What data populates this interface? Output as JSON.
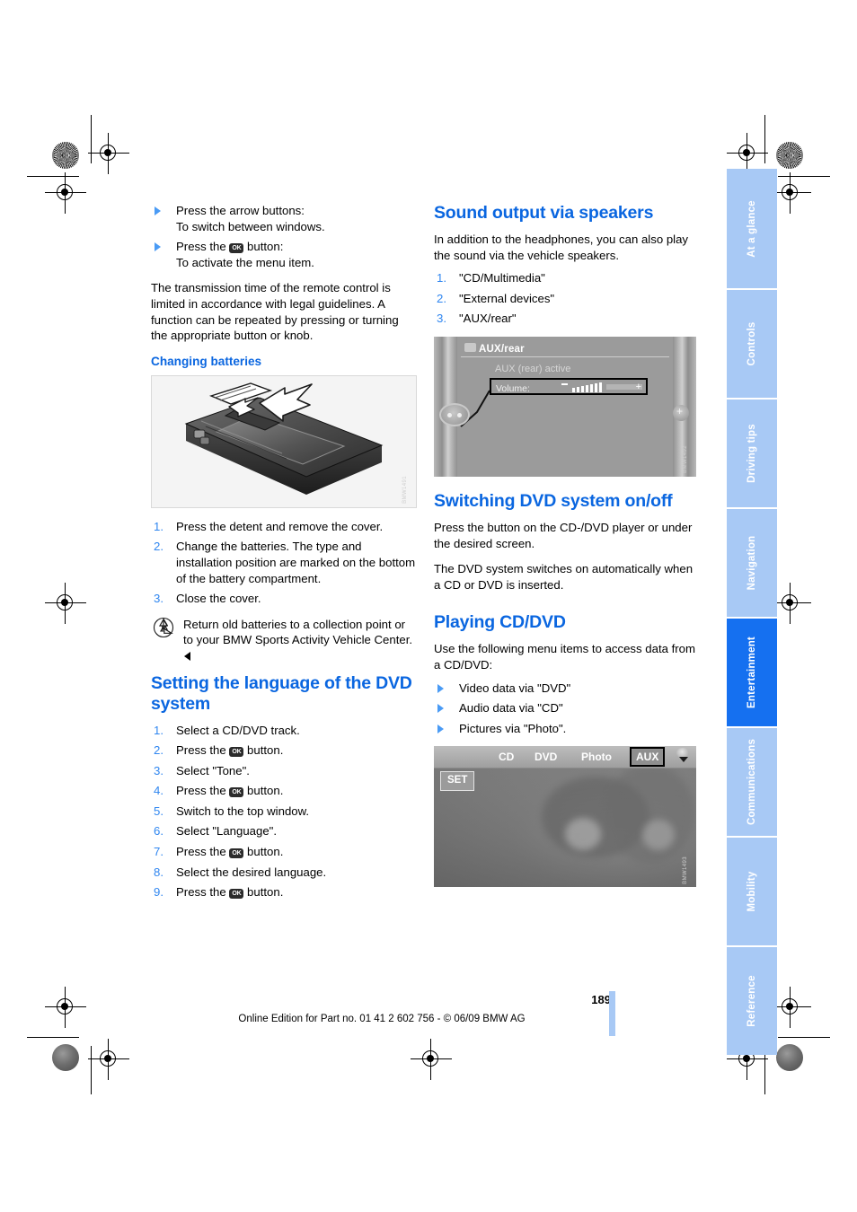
{
  "document": {
    "page_number": "189",
    "footer": "Online Edition for Part no. 01 41 2 602 756 - © 06/09 BMW AG"
  },
  "left_column": {
    "bullets_top": [
      {
        "line1": "Press the arrow buttons:",
        "line2": "To switch between windows."
      },
      {
        "line1_pre": "Press the ",
        "icon": "OK",
        "line1_post": " button:",
        "line2": "To activate the menu item."
      }
    ],
    "paragraph_transmission": "The transmission time of the remote control is limited in accordance with legal guidelines. A function can be repeated by pressing or turning the appropriate button or knob.",
    "changing_batteries": {
      "heading": "Changing batteries",
      "figure_name": "remote-control-battery-cover-illustration",
      "steps": [
        "Press the detent and remove the cover.",
        "Change the batteries. The type and installation position are marked on the bottom of the battery compartment.",
        "Close the cover."
      ],
      "note": "Return old batteries to a collection point or to your BMW Sports Activity Vehicle Center."
    },
    "setting_language": {
      "heading": "Setting the language of the DVD system",
      "steps": [
        {
          "text": "Select a CD/DVD track."
        },
        {
          "pre": "Press the ",
          "icon": "OK",
          "post": " button."
        },
        {
          "text": "Select \"Tone\"."
        },
        {
          "pre": "Press the ",
          "icon": "OK",
          "post": " button."
        },
        {
          "text": "Switch to the top window."
        },
        {
          "text": "Select \"Language\"."
        },
        {
          "pre": "Press the ",
          "icon": "OK",
          "post": " button."
        },
        {
          "text": "Select the desired language."
        },
        {
          "pre": "Press the ",
          "icon": "OK",
          "post": " button."
        }
      ]
    }
  },
  "right_column": {
    "sound_output": {
      "heading": "Sound output via speakers",
      "paragraph": "In addition to the headphones, you can also play the sound via the vehicle speakers.",
      "steps": [
        "\"CD/Multimedia\"",
        "\"External devices\"",
        "\"AUX/rear\""
      ]
    },
    "aux_screen": {
      "title": "AUX/rear",
      "status": "AUX (rear) active",
      "volume_label": "Volume:",
      "minus_label": "–",
      "plus_label": "+"
    },
    "switching_dvd": {
      "heading": "Switching DVD system on/off",
      "paragraph1": "Press the button on the CD-/DVD player or under the desired screen.",
      "paragraph2": "The DVD system switches on automatically when a CD or DVD is inserted."
    },
    "playing_cd_dvd": {
      "heading": "Playing CD/DVD",
      "paragraph": "Use the following menu items to access data from a CD/DVD:",
      "bullets": [
        "Video data via \"DVD\"",
        "Audio data via \"CD\"",
        "Pictures via \"Photo\"."
      ]
    },
    "menu_screen": {
      "items": [
        "CD",
        "DVD",
        "Photo"
      ],
      "selected_item": "AUX",
      "set_button": "SET"
    }
  },
  "index_tabs": {
    "items": [
      {
        "label": "At a glance",
        "active": false
      },
      {
        "label": "Controls",
        "active": false
      },
      {
        "label": "Driving tips",
        "active": false
      },
      {
        "label": "Navigation",
        "active": false
      },
      {
        "label": "Entertainment",
        "active": true
      },
      {
        "label": "Communications",
        "active": false
      },
      {
        "label": "Mobility",
        "active": false
      },
      {
        "label": "Reference",
        "active": false
      }
    ]
  },
  "colors": {
    "heading_blue": "#0a66e0",
    "tab_blue": "#a8c9f5",
    "tab_active_blue": "#1570f0",
    "number_blue": "#2f86f0"
  }
}
